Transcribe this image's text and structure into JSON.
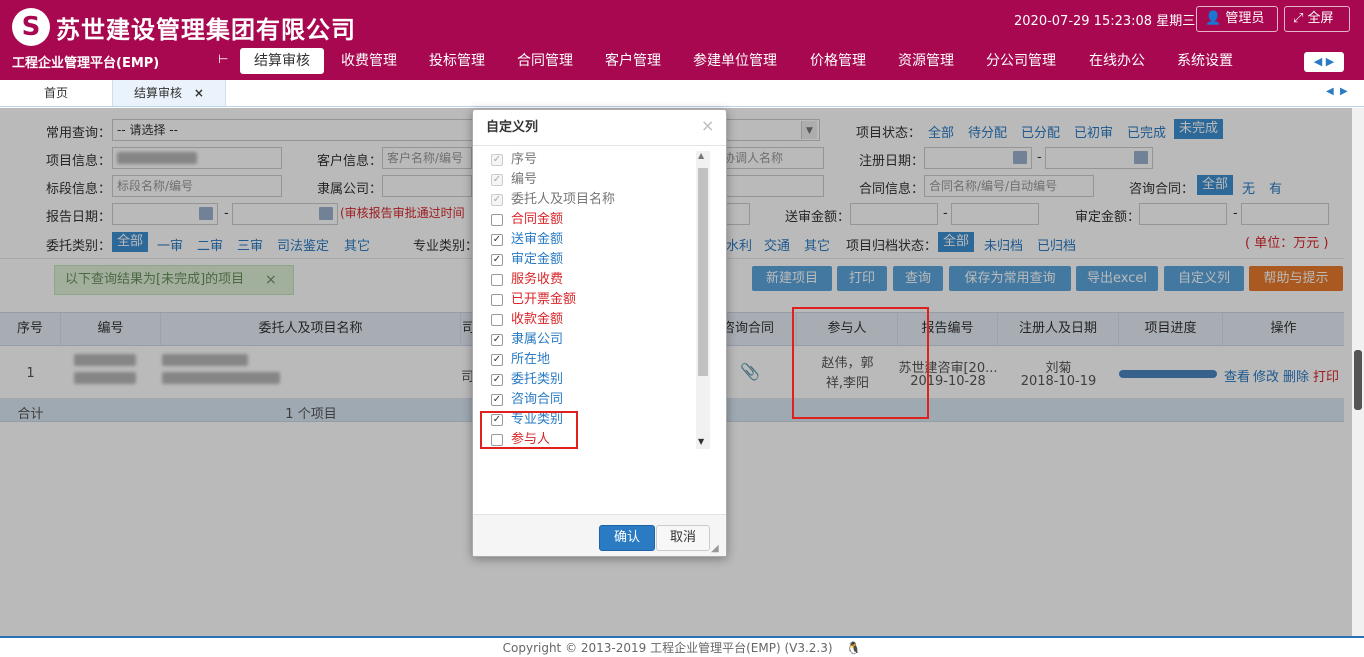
{
  "header": {
    "logo_letter": "S",
    "company": "苏世建设管理集团有限公司",
    "platform": "工程企业管理平台(EMP)",
    "datetime": "2020-07-29 15:23:08 星期三",
    "admin_label": "管理员",
    "fullscreen_label": "全屏",
    "nav": [
      "结算审核",
      "收费管理",
      "投标管理",
      "合同管理",
      "客户管理",
      "参建单位管理",
      "价格管理",
      "资源管理",
      "分公司管理",
      "在线办公",
      "系统设置"
    ],
    "active_nav": "结算审核",
    "colors": {
      "brand": "#a8084f",
      "accent": "#2a7bc4"
    }
  },
  "tabs": {
    "home": "首页",
    "current": "结算审核",
    "close": "×"
  },
  "filters": {
    "common_query_label": "常用查询：",
    "common_query_value": "-- 请选择 --",
    "project_info_label": "项目信息：",
    "customer_info_label": "客户信息：",
    "customer_info_placeholder": "客户名称/编号",
    "mediator_placeholder": "协调人名称",
    "section_info_label": "标段信息：",
    "section_info_placeholder": "标段名称/编号",
    "affiliated_company_label": "隶属公司：",
    "report_date_label": "报告日期：",
    "report_date_note": "(审核报告审批通过时间",
    "delegation_type_label": "委托类别：",
    "delegation_types": [
      "全部",
      "一审",
      "二审",
      "三审",
      "司法鉴定",
      "其它"
    ],
    "specialty_label": "专业类别：",
    "specialty_types_visible": [
      "水利",
      "交通",
      "其它"
    ],
    "project_status_label": "项目状态：",
    "project_statuses": [
      "全部",
      "待分配",
      "已分配",
      "已初审",
      "已完成",
      "未完成"
    ],
    "project_status_selected": "未完成",
    "register_date_label": "注册日期：",
    "contract_info_label": "合同信息：",
    "contract_info_placeholder": "合同名称/编号/自动编号",
    "consult_contract_label": "咨询合同：",
    "consult_contract_options": [
      "全部",
      "无",
      "有"
    ],
    "submit_amount_label": "送审金额：",
    "approved_amount_label": "审定金额：",
    "archive_status_label": "项目归档状态：",
    "archive_statuses": [
      "全部",
      "未归档",
      "已归档"
    ],
    "unit_note": "( 单位：万元 )",
    "dash": "-"
  },
  "result_toast": {
    "text": "以下查询结果为[未完成]的项目",
    "close": "×"
  },
  "actions": [
    "新建项目",
    "打印",
    "查询",
    "保存为常用查询",
    "导出excel",
    "自定义列",
    "帮助与提示"
  ],
  "table": {
    "columns": [
      "序号",
      "编号",
      "委托人及项目名称",
      "司",
      "咨询合同",
      "参与人",
      "报告编号",
      "注册人及日期",
      "项目进度",
      "操作"
    ],
    "rows": [
      {
        "index": "1",
        "participants": "赵伟，郭祥,李阳",
        "report_no": "苏世建咨审[20...",
        "report_date": "2019-10-28",
        "registrant": "刘菊",
        "register_date": "2018-10-19",
        "partial_col": "司",
        "progress": 1.0,
        "ops": [
          "查看",
          "修改",
          "删除",
          "打印"
        ]
      }
    ],
    "sum_label": "合计",
    "sum_count": "1 个项目"
  },
  "dialog": {
    "title": "自定义列",
    "close": "×",
    "items": [
      {
        "label": "序号",
        "checked": true,
        "disabled": true,
        "color": "gray"
      },
      {
        "label": "编号",
        "checked": true,
        "disabled": true,
        "color": "gray"
      },
      {
        "label": "委托人及项目名称",
        "checked": true,
        "disabled": true,
        "color": "gray"
      },
      {
        "label": "合同金额",
        "checked": false,
        "disabled": false,
        "color": "red"
      },
      {
        "label": "送审金额",
        "checked": true,
        "disabled": false,
        "color": "blue"
      },
      {
        "label": "审定金额",
        "checked": true,
        "disabled": false,
        "color": "blue"
      },
      {
        "label": "服务收费",
        "checked": false,
        "disabled": false,
        "color": "red"
      },
      {
        "label": "已开票金额",
        "checked": false,
        "disabled": false,
        "color": "red"
      },
      {
        "label": "收款金额",
        "checked": false,
        "disabled": false,
        "color": "red"
      },
      {
        "label": "隶属公司",
        "checked": true,
        "disabled": false,
        "color": "blue"
      },
      {
        "label": "所在地",
        "checked": true,
        "disabled": false,
        "color": "blue"
      },
      {
        "label": "委托类别",
        "checked": true,
        "disabled": false,
        "color": "blue"
      },
      {
        "label": "咨询合同",
        "checked": true,
        "disabled": false,
        "color": "blue"
      },
      {
        "label": "专业类别",
        "checked": true,
        "disabled": false,
        "color": "blue"
      },
      {
        "label": "参与人",
        "checked": false,
        "disabled": false,
        "color": "red"
      }
    ],
    "ok_label": "确认",
    "cancel_label": "取消"
  },
  "footer": {
    "copyright": "Copyright © 2013-2019 工程企业管理平台(EMP) (V3.2.3)"
  }
}
